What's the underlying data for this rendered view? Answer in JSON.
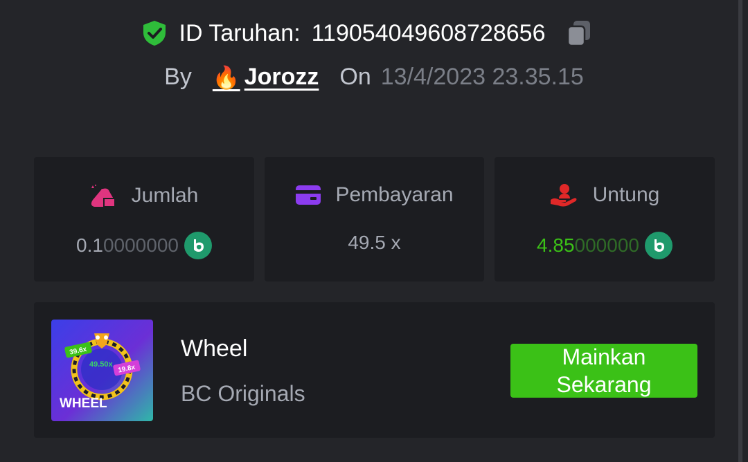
{
  "bet": {
    "id_label": "ID Taruhan:",
    "id_value": "119054049608728656",
    "by_label": "By",
    "user_emoji": "🔥",
    "user_name": "Jorozz",
    "on_label": "On",
    "datetime": "13/4/2023 23.35.15"
  },
  "stats": {
    "amount": {
      "label": "Jumlah",
      "value_main": "0.1",
      "value_trailing": "0000000",
      "icon": "money-bag-icon",
      "color": "#e0357f"
    },
    "payout": {
      "label": "Pembayaran",
      "value": "49.5 x",
      "icon": "card-icon",
      "color": "#8c3cf0"
    },
    "profit": {
      "label": "Untung",
      "value_main": "4.85",
      "value_trailing": "000000",
      "icon": "profit-hand-icon",
      "color": "#e02828",
      "value_color": "#3bc117"
    }
  },
  "game": {
    "name": "Wheel",
    "provider": "BC Originals",
    "thumb_title": "WHEEL",
    "thumb_values": [
      "39.6x",
      "49.50x",
      "19.8x"
    ],
    "play_line1": "Mainkan",
    "play_line2": "Sekarang"
  },
  "colors": {
    "background": "#242529",
    "card": "#1c1d21",
    "accent_green": "#3bc117",
    "coin": "#1f9a6c"
  }
}
